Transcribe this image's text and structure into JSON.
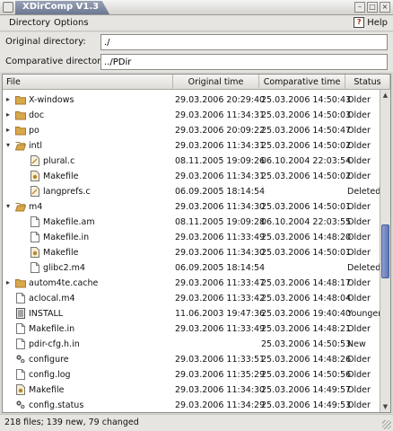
{
  "window": {
    "title": "XDirComp V1.3"
  },
  "menu": {
    "directory": "Directory",
    "options": "Options",
    "help": "Help"
  },
  "fields": {
    "original_label": "Original directory:",
    "original_value": "./",
    "comparative_label": "Comparative directory:",
    "comparative_value": "../PDir"
  },
  "columns": {
    "file": "File",
    "orig": "Original time",
    "comp": "Comparative time",
    "status": "Status"
  },
  "rows": [
    {
      "level": 0,
      "type": "folder-closed",
      "name": "X-windows",
      "orig": "29.03.2006 20:29:40",
      "comp": "25.03.2006 14:50:43",
      "status": "Older"
    },
    {
      "level": 0,
      "type": "folder-closed",
      "name": "doc",
      "orig": "29.03.2006 11:34:31",
      "comp": "25.03.2006 14:50:03",
      "status": "Older"
    },
    {
      "level": 0,
      "type": "folder-closed",
      "name": "po",
      "orig": "29.03.2006 20:09:22",
      "comp": "25.03.2006 14:50:47",
      "status": "Older"
    },
    {
      "level": 0,
      "type": "folder-open",
      "name": "intl",
      "orig": "29.03.2006 11:34:31",
      "comp": "25.03.2006 14:50:02",
      "status": "Older"
    },
    {
      "level": 1,
      "type": "c-file",
      "name": "plural.c",
      "orig": "08.11.2005 19:09:26",
      "comp": "06.10.2004 22:03:54",
      "status": "Older"
    },
    {
      "level": 1,
      "type": "makefile",
      "name": "Makefile",
      "orig": "29.03.2006 11:34:31",
      "comp": "25.03.2006 14:50:02",
      "status": "Older"
    },
    {
      "level": 1,
      "type": "c-file",
      "name": "langprefs.c",
      "orig": "06.09.2005 18:14:54",
      "comp": "",
      "status": "Deleted"
    },
    {
      "level": 0,
      "type": "folder-open",
      "name": "m4",
      "orig": "29.03.2006 11:34:30",
      "comp": "25.03.2006 14:50:01",
      "status": "Older"
    },
    {
      "level": 1,
      "type": "file",
      "name": "Makefile.am",
      "orig": "08.11.2005 19:09:28",
      "comp": "06.10.2004 22:03:55",
      "status": "Older"
    },
    {
      "level": 1,
      "type": "file",
      "name": "Makefile.in",
      "orig": "29.03.2006 11:33:49",
      "comp": "25.03.2006 14:48:20",
      "status": "Older"
    },
    {
      "level": 1,
      "type": "makefile",
      "name": "Makefile",
      "orig": "29.03.2006 11:34:30",
      "comp": "25.03.2006 14:50:01",
      "status": "Older"
    },
    {
      "level": 1,
      "type": "file",
      "name": "glibc2.m4",
      "orig": "06.09.2005 18:14:54",
      "comp": "",
      "status": "Deleted"
    },
    {
      "level": 0,
      "type": "folder-closed",
      "name": "autom4te.cache",
      "orig": "29.03.2006 11:33:47",
      "comp": "25.03.2006 14:48:17",
      "status": "Older"
    },
    {
      "level": 0,
      "type": "file",
      "name": "aclocal.m4",
      "orig": "29.03.2006 11:33:42",
      "comp": "25.03.2006 14:48:04",
      "status": "Older"
    },
    {
      "level": 0,
      "type": "text-file",
      "name": "INSTALL",
      "orig": "11.06.2003 19:47:36",
      "comp": "25.03.2006 19:40:40",
      "status": "Younger"
    },
    {
      "level": 0,
      "type": "file",
      "name": "Makefile.in",
      "orig": "29.03.2006 11:33:49",
      "comp": "25.03.2006 14:48:21",
      "status": "Older"
    },
    {
      "level": 0,
      "type": "file",
      "name": "pdir-cfg.h.in",
      "orig": "",
      "comp": "25.03.2006 14:50:53",
      "status": "New"
    },
    {
      "level": 0,
      "type": "script",
      "name": "configure",
      "orig": "29.03.2006 11:33:51",
      "comp": "25.03.2006 14:48:26",
      "status": "Older"
    },
    {
      "level": 0,
      "type": "file",
      "name": "config.log",
      "orig": "29.03.2006 11:35:29",
      "comp": "25.03.2006 14:50:56",
      "status": "Older"
    },
    {
      "level": 0,
      "type": "makefile",
      "name": "Makefile",
      "orig": "29.03.2006 11:34:30",
      "comp": "25.03.2006 14:49:57",
      "status": "Older"
    },
    {
      "level": 0,
      "type": "script",
      "name": "config.status",
      "orig": "29.03.2006 11:34:29",
      "comp": "25.03.2006 14:49:53",
      "status": "Older"
    }
  ],
  "status_bar": {
    "text": "218 files; 139 new, 79 changed"
  },
  "colors": {
    "folder": "#d9a84a",
    "folder_dark": "#a87a2a",
    "title_tab": "#7e89a2",
    "scroll_thumb": "#6f86c2"
  },
  "icons": {
    "folder-closed": "folder-icon",
    "folder-open": "folder-open-icon",
    "c-file": "c-source-file-icon",
    "makefile": "makefile-icon",
    "file": "file-icon",
    "text-file": "text-file-icon",
    "script": "script-icon"
  }
}
